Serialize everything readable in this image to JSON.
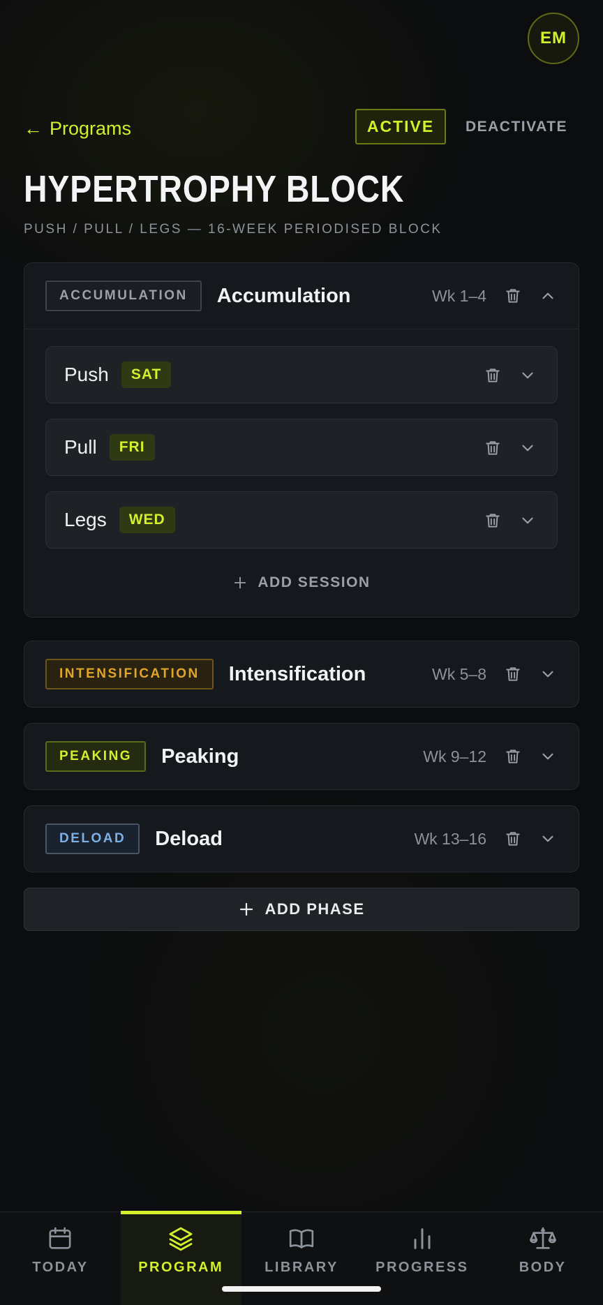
{
  "avatar": {
    "initials": "EM"
  },
  "nav": {
    "back_label": "Programs",
    "back_arrow": "←"
  },
  "status": {
    "active_label": "ACTIVE",
    "deactivate_label": "DEACTIVATE"
  },
  "program": {
    "title": "HYPERTROPHY BLOCK",
    "subtitle": "PUSH / PULL / LEGS — 16-WEEK PERIODISED BLOCK"
  },
  "phases": [
    {
      "tag": "ACCUMULATION",
      "name": "Accumulation",
      "weeks": "Wk 1–4",
      "expanded": true,
      "sessions": [
        {
          "name": "Push",
          "day": "SAT"
        },
        {
          "name": "Pull",
          "day": "FRI"
        },
        {
          "name": "Legs",
          "day": "WED"
        }
      ],
      "add_session_label": "ADD SESSION"
    },
    {
      "tag": "INTENSIFICATION",
      "name": "Intensification",
      "weeks": "Wk 5–8",
      "expanded": false
    },
    {
      "tag": "PEAKING",
      "name": "Peaking",
      "weeks": "Wk 9–12",
      "expanded": false
    },
    {
      "tag": "DELOAD",
      "name": "Deload",
      "weeks": "Wk 13–16",
      "expanded": false
    }
  ],
  "add_phase_label": "ADD PHASE",
  "bottom_nav": [
    {
      "label": "TODAY",
      "icon": "calendar-icon",
      "active": false
    },
    {
      "label": "PROGRAM",
      "icon": "layers-icon",
      "active": true
    },
    {
      "label": "LIBRARY",
      "icon": "book-icon",
      "active": false
    },
    {
      "label": "PROGRESS",
      "icon": "bar-chart-icon",
      "active": false
    },
    {
      "label": "BODY",
      "icon": "scale-icon",
      "active": false
    }
  ],
  "colors": {
    "accent": "#d4ef2b",
    "intensification": "#e0a52a",
    "deload": "#7db0e4",
    "card": "#15181c",
    "background": "#0c0d0e"
  }
}
